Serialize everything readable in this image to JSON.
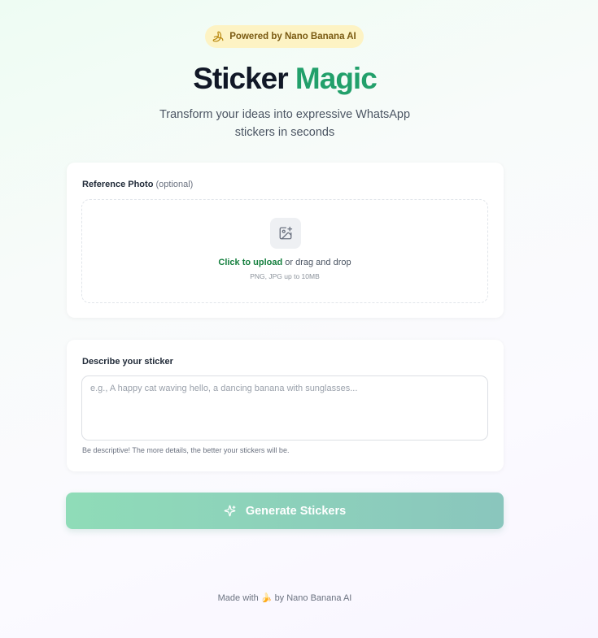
{
  "badge": {
    "icon": "banana-icon",
    "text": "Powered by Nano Banana AI"
  },
  "hero": {
    "title_main": "Sticker",
    "title_accent": "Magic",
    "subtitle": "Transform your ideas into expressive WhatsApp stickers in seconds"
  },
  "upload": {
    "label": "Reference Photo",
    "optional": "(optional)",
    "icon": "image-plus-icon",
    "link_text": "Click to upload",
    "rest_text": " or drag and drop",
    "hint": "PNG, JPG up to 10MB"
  },
  "describe": {
    "label": "Describe your sticker",
    "value": "",
    "placeholder": "e.g., A happy cat waving hello, a dancing banana with sunglasses...",
    "helper": "Be descriptive! The more details, the better your stickers will be."
  },
  "generate": {
    "icon": "sparkles-icon",
    "label": "Generate Stickers"
  },
  "footer": {
    "text": "Made with 🍌 by Nano Banana AI"
  },
  "colors": {
    "accent": "#22a06b",
    "link": "#16803f",
    "badge_bg": "#fdf3c4",
    "button_start": "#8fdcb8",
    "button_end": "#8ac6bd"
  }
}
